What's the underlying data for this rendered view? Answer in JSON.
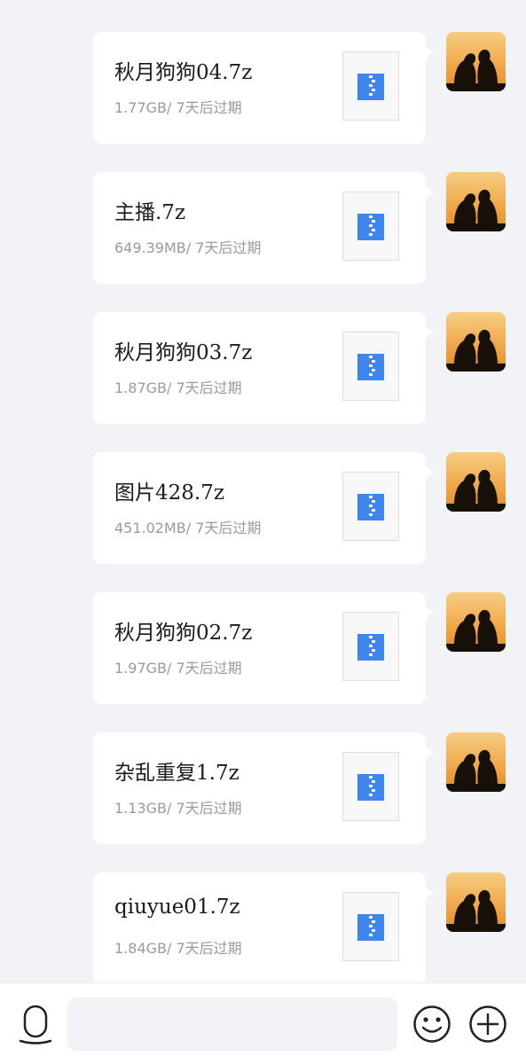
{
  "messages": [
    {
      "name": "秋月狗狗04.7z",
      "meta": "1.77GB/ 7天后过期"
    },
    {
      "name": "主播.7z",
      "meta": "649.39MB/ 7天后过期"
    },
    {
      "name": "秋月狗狗03.7z",
      "meta": "1.87GB/ 7天后过期"
    },
    {
      "name": "图片428.7z",
      "meta": "451.02MB/ 7天后过期"
    },
    {
      "name": "秋月狗狗02.7z",
      "meta": "1.97GB/ 7天后过期"
    },
    {
      "name": "杂乱重复1.7z",
      "meta": "1.13GB/ 7天后过期"
    },
    {
      "name": "qiuyue01.7z",
      "meta": "1.84GB/ 7天后过期"
    }
  ],
  "input": {
    "value": "",
    "placeholder": ""
  },
  "icons": {
    "file": "zip-file-icon",
    "avatar": "avatar-silhouette",
    "voice": "microphone-icon",
    "emoji": "smiley-icon",
    "more": "plus-circle-icon"
  },
  "colors": {
    "zip_blue": "#3d86f0",
    "background": "#f2f3f7",
    "meta_gray": "#9a9a9a"
  }
}
